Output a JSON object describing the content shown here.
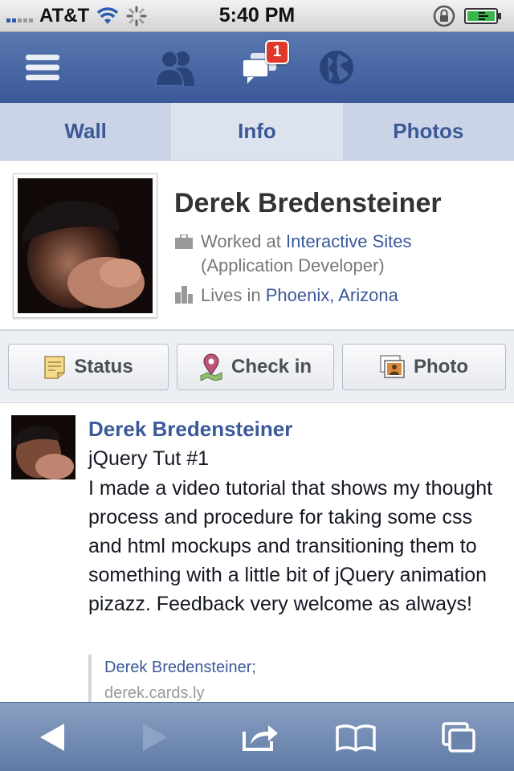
{
  "status_bar": {
    "carrier": "AT&T",
    "time": "5:40 PM",
    "icons": [
      "signal-icon",
      "wifi-icon",
      "activity-spinner-icon",
      "rotation-lock-icon",
      "battery-charging-icon"
    ]
  },
  "navbar": {
    "icons": [
      "menu-icon",
      "friend-requests-icon",
      "messages-icon",
      "notifications-globe-icon"
    ],
    "messages_badge": "1"
  },
  "tabs": [
    {
      "label": "Wall",
      "active": false
    },
    {
      "label": "Info",
      "active": true
    },
    {
      "label": "Photos",
      "active": false
    }
  ],
  "profile": {
    "name": "Derek Bredensteiner",
    "work_prefix": "Worked at",
    "work_place": "Interactive Sites",
    "work_title": "(Application Developer)",
    "lives_prefix": "Lives in",
    "lives_place": "Phoenix, Arizona"
  },
  "actions": [
    {
      "label": "Status",
      "icon": "status-note-icon"
    },
    {
      "label": "Check in",
      "icon": "map-pin-icon"
    },
    {
      "label": "Photo",
      "icon": "photo-icon"
    }
  ],
  "post": {
    "author": "Derek Bredensteiner",
    "title": "jQuery Tut #1",
    "body": "I made a video tutorial that shows my thought process and procedure for taking some css and html mockups and transitioning them to something with a little bit of jQuery animation pizazz. Feedback very welcome as always!",
    "attachment_name": "Derek Bredensteiner;",
    "attachment_url": "derek.cards.ly"
  },
  "toolbar": {
    "icons": [
      "back-arrow-icon",
      "forward-arrow-icon",
      "share-icon",
      "bookmarks-icon",
      "tabs-icon"
    ]
  },
  "colors": {
    "brand": "#3b5998",
    "badge": "#e0392b",
    "toolbar": "#6a84ad"
  }
}
